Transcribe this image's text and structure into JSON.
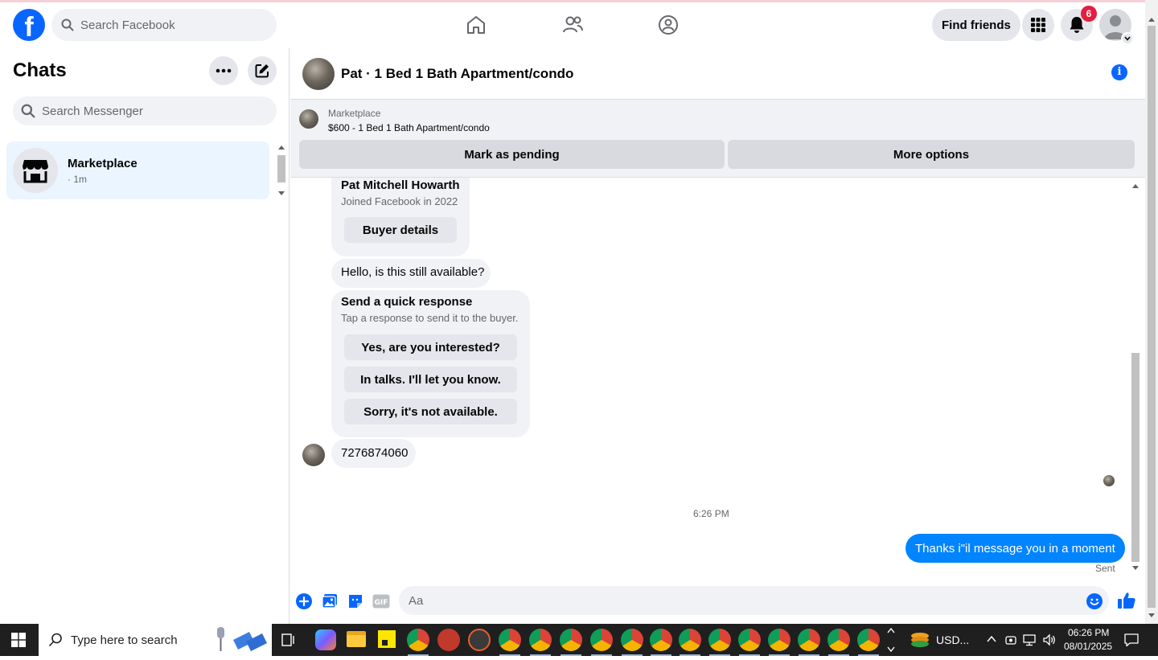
{
  "topbar": {
    "logo_letter": "f",
    "search_placeholder": "Search Facebook",
    "find_friends": "Find friends",
    "notification_count": "6"
  },
  "left": {
    "title": "Chats",
    "search_placeholder": "Search Messenger",
    "chats": [
      {
        "name": "Marketplace",
        "time": "· 1m"
      }
    ]
  },
  "conversation": {
    "title": "Pat · 1 Bed 1 Bath Apartment/condo",
    "marketplace": {
      "label": "Marketplace",
      "listing": "$600 - 1 Bed 1 Bath Apartment/condo",
      "mark_pending": "Mark as pending",
      "more_options": "More options"
    },
    "buyer": {
      "name": "Pat Mitchell Howarth",
      "joined": "Joined Facebook in 2022",
      "details_button": "Buyer details"
    },
    "incoming_1": "Hello, is this still available?",
    "quick_response": {
      "title": "Send a quick response",
      "subtitle": "Tap a response to send it to the buyer.",
      "options": [
        "Yes, are you interested?",
        "In talks. I'll let you know.",
        "Sorry, it's not available."
      ]
    },
    "incoming_2": "7276874060",
    "timestamp": "6:26 PM",
    "outgoing": "Thanks i\"il message you in a moment",
    "status": "Sent",
    "composer_placeholder": "Aa"
  },
  "taskbar": {
    "search_placeholder": "Type here to search",
    "currency": "USD...",
    "time": "06:26 PM",
    "date": "08/01/2025"
  },
  "colors": {
    "brand_blue": "#0866ff",
    "sent_bubble": "#0084ff",
    "badge_red": "#e41e3f"
  }
}
